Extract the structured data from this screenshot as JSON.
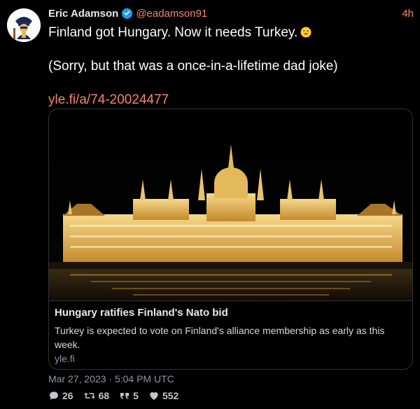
{
  "tweet": {
    "author_name": "Eric Adamson",
    "handle": "@eadamson91",
    "time_ago": "4h",
    "text_line1": "Finland got Hungary. Now it needs Turkey.",
    "text_line2": "(Sorry, but that was a once-in-a-lifetime dad joke)",
    "link": "yle.fi/a/74-20024477",
    "emoji": "winking-face-emoji"
  },
  "card": {
    "title": "Hungary ratifies Finland's Nato bid",
    "description": "Turkey is expected to vote on Finland's alliance membership as early as this week.",
    "domain": "yle.fi"
  },
  "meta": {
    "date": "Mar 27, 2023 · 5:04 PM UTC"
  },
  "stats": {
    "replies": "26",
    "retweets": "68",
    "quotes": "5",
    "likes": "552"
  },
  "colors": {
    "accent": "#f4856f",
    "verified": "#1d9bf0",
    "background": "#000000"
  }
}
